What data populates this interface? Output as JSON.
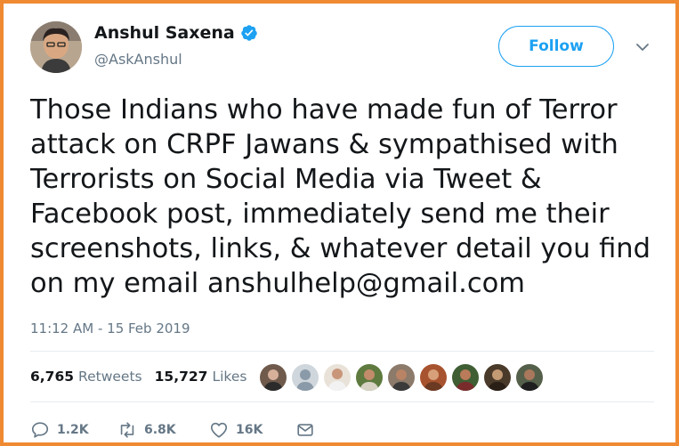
{
  "author": {
    "name": "Anshul Saxena",
    "handle": "@AskAnshul",
    "verified": true
  },
  "follow_label": "Follow",
  "tweet_text": "Those Indians who have made fun of Terror\nattack on CRPF Jawans & sympathised with\nTerrorists on Social Media via Tweet &\nFacebook post, immediately send me their\nscreenshots, links, & whatever detail you find\non my email anshulhelp@gmail.com",
  "timestamp": "11:12 AM - 15 Feb 2019",
  "stats": {
    "retweets_count": "6,765",
    "retweets_label": "Retweets",
    "likes_count": "15,727",
    "likes_label": "Likes"
  },
  "actions": {
    "reply_count": "1.2K",
    "retweet_count": "6.8K",
    "like_count": "16K"
  },
  "colors": {
    "border": "#ef8a33",
    "accent": "#1da1f2",
    "muted": "#657786",
    "text": "#14171a"
  },
  "icons": [
    "verified-badge-icon",
    "chevron-down-icon",
    "reply-icon",
    "retweet-icon",
    "like-icon",
    "direct-message-icon"
  ]
}
